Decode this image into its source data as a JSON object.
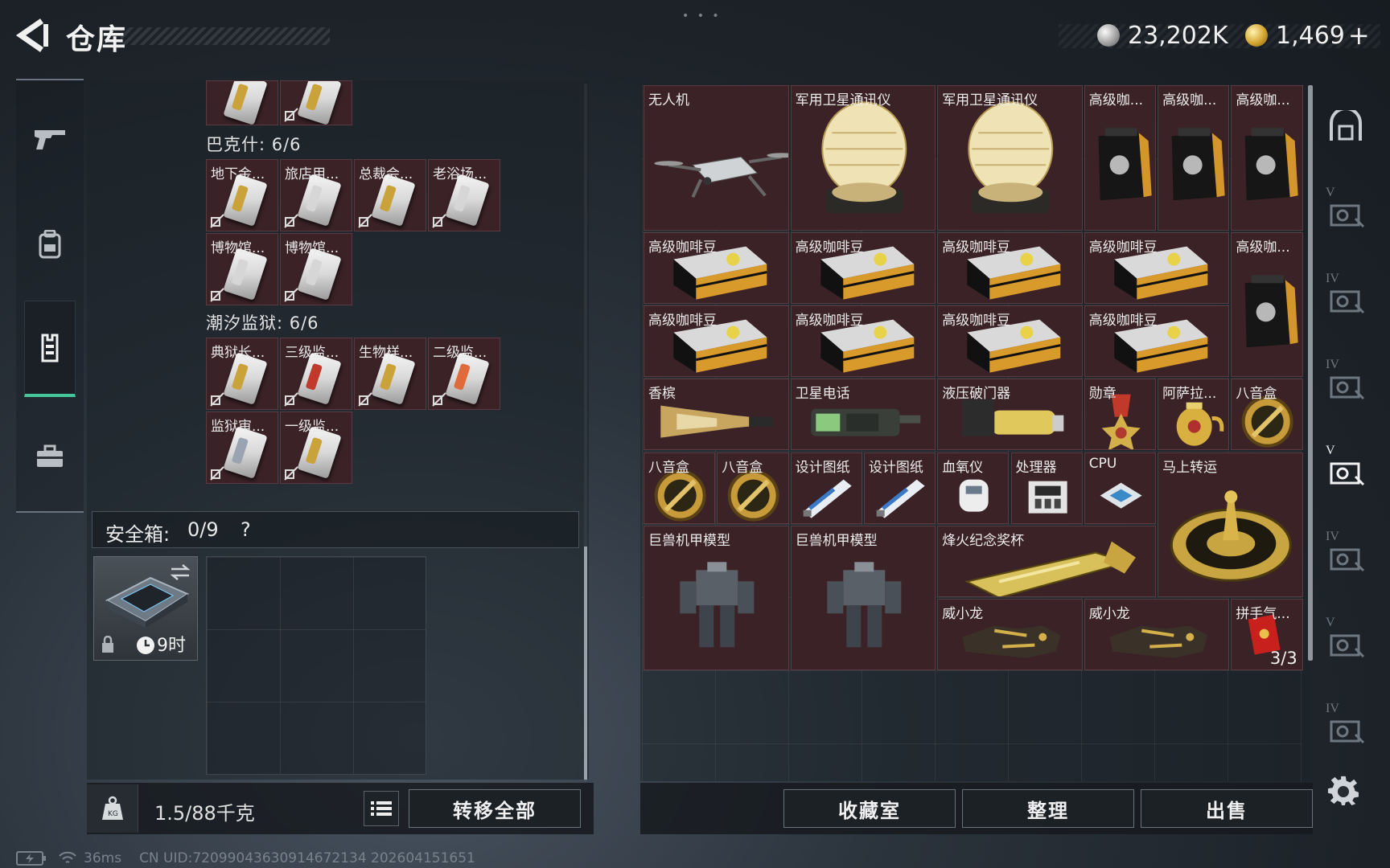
{
  "header": {
    "title": "仓库",
    "currency_silver": "23,202K",
    "currency_gold": "1,469",
    "plus_label": "+"
  },
  "left_nav": {
    "items": [
      {
        "icon": "gun-icon"
      },
      {
        "icon": "backpack-icon"
      },
      {
        "icon": "vest-icon",
        "active": true
      },
      {
        "icon": "toolbox-icon"
      }
    ]
  },
  "keycard_groups": [
    {
      "title": "",
      "cards": [
        {
          "label": ""
        },
        {
          "label": ""
        }
      ]
    },
    {
      "title": "巴克什: 6/6",
      "cards": [
        {
          "label": "地下金..."
        },
        {
          "label": "旅店用..."
        },
        {
          "label": "总裁会..."
        },
        {
          "label": "老浴场..."
        },
        {
          "label": "博物馆..."
        },
        {
          "label": "博物馆..."
        }
      ]
    },
    {
      "title": "潮汐监狱: 6/6",
      "cards": [
        {
          "label": "典狱长..."
        },
        {
          "label": "三级监..."
        },
        {
          "label": "生物样..."
        },
        {
          "label": "二级监..."
        },
        {
          "label": "监狱审..."
        },
        {
          "label": "一级监..."
        }
      ]
    }
  ],
  "safe_box": {
    "label": "安全箱:",
    "count": "0/9",
    "help": "?",
    "timer": "9时"
  },
  "bottom_left": {
    "weight": "1.5/88千克",
    "transfer_all": "转移全部"
  },
  "stash_items": [
    {
      "label": "无人机",
      "icon": "drone"
    },
    {
      "label": "军用卫星通讯仪",
      "icon": "satellite-dish"
    },
    {
      "label": "军用卫星通讯仪",
      "icon": "satellite-dish"
    },
    {
      "label": "高级咖...",
      "icon": "coffee-bag"
    },
    {
      "label": "高级咖...",
      "icon": "coffee-bag"
    },
    {
      "label": "高级咖...",
      "icon": "coffee-bag"
    },
    {
      "label": "高级咖啡豆",
      "icon": "coffee-box"
    },
    {
      "label": "高级咖啡豆",
      "icon": "coffee-box"
    },
    {
      "label": "高级咖啡豆",
      "icon": "coffee-box"
    },
    {
      "label": "高级咖啡豆",
      "icon": "coffee-box"
    },
    {
      "label": "高级咖...",
      "icon": "coffee-bag"
    },
    {
      "label": "高级咖啡豆",
      "icon": "coffee-box"
    },
    {
      "label": "高级咖啡豆",
      "icon": "coffee-box"
    },
    {
      "label": "高级咖啡豆",
      "icon": "coffee-box"
    },
    {
      "label": "高级咖啡豆",
      "icon": "coffee-box"
    },
    {
      "label": "香槟",
      "icon": "champagne"
    },
    {
      "label": "卫星电话",
      "icon": "sat-phone"
    },
    {
      "label": "液压破门器",
      "icon": "breacher"
    },
    {
      "label": "勋章",
      "icon": "medal"
    },
    {
      "label": "阿萨拉...",
      "icon": "teapot"
    },
    {
      "label": "八音盒",
      "icon": "music-box"
    },
    {
      "label": "八音盒",
      "icon": "music-box"
    },
    {
      "label": "八音盒",
      "icon": "music-box"
    },
    {
      "label": "设计图纸",
      "icon": "blueprint"
    },
    {
      "label": "设计图纸",
      "icon": "blueprint"
    },
    {
      "label": "血氧仪",
      "icon": "oximeter"
    },
    {
      "label": "处理器",
      "icon": "processor"
    },
    {
      "label": "CPU",
      "icon": "cpu"
    },
    {
      "label": "马上转运",
      "icon": "roulette"
    },
    {
      "label": "巨兽机甲模型",
      "icon": "mech"
    },
    {
      "label": "巨兽机甲模型",
      "icon": "mech"
    },
    {
      "label": "烽火纪念奖杯",
      "icon": "trophy"
    },
    {
      "label": "威小龙",
      "icon": "dragon-glove"
    },
    {
      "label": "威小龙",
      "icon": "dragon-glove"
    },
    {
      "label": "拼手气...",
      "icon": "red-envelope",
      "count": "3/3"
    }
  ],
  "bottom_right": {
    "collection": "收藏室",
    "organize": "整理",
    "sell": "出售"
  },
  "right_nav": {
    "tiers": [
      "",
      "V",
      "IV",
      "IV",
      "V",
      "IV",
      "V",
      "IV"
    ]
  },
  "status": {
    "ping": "36ms",
    "uid": "CN UID:7209904363091467213​4 202604151651"
  },
  "colors": {
    "accent": "#46c79b",
    "item_bg": "#3b2226",
    "gold": "#d4a431"
  }
}
